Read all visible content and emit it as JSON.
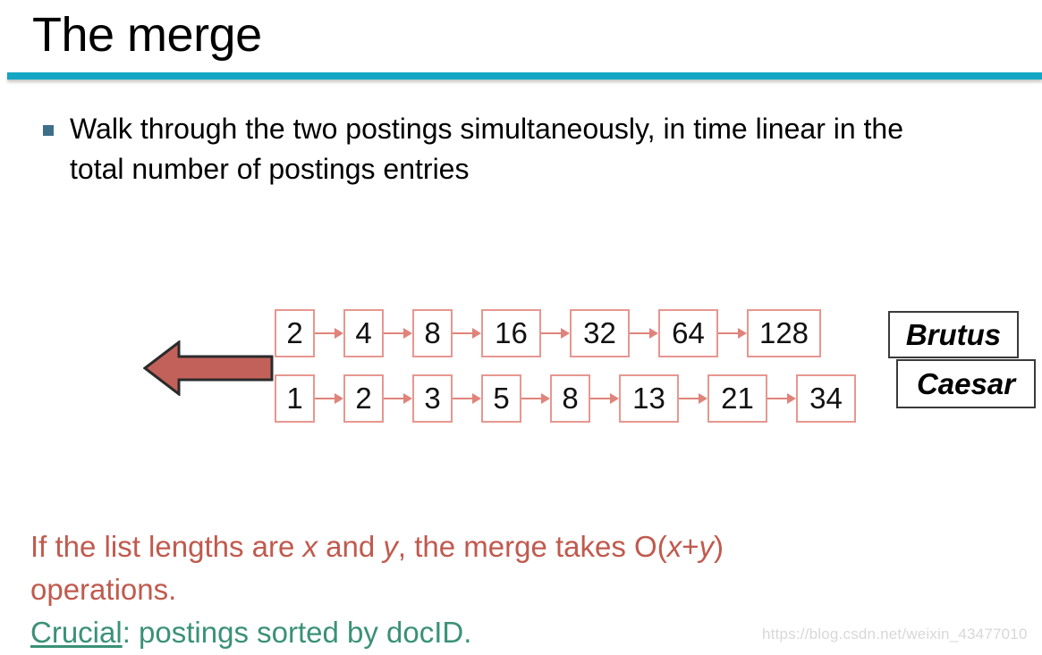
{
  "slide": {
    "title": "The merge",
    "rule_color": "#14a6c4"
  },
  "bullet": {
    "marker": "square-bullet",
    "marker_color": "#3d6e8a",
    "text": "Walk through the two postings simultaneously, in time linear in the total number of postings entries"
  },
  "diagram": {
    "arrow": {
      "name": "big-left-arrow",
      "direction": "left",
      "fill_color": "#c2615a",
      "stroke_color": "#2b2b2b"
    },
    "box_border_color": "#e79790",
    "connector_color": "#e0837a",
    "rows": [
      {
        "term": "Brutus",
        "postings": [
          "2",
          "4",
          "8",
          "16",
          "32",
          "64",
          "128"
        ]
      },
      {
        "term": "Caesar",
        "postings": [
          "1",
          "2",
          "3",
          "5",
          "8",
          "13",
          "21",
          "34"
        ]
      }
    ]
  },
  "bottom": {
    "line1_part1": "If the list lengths are ",
    "line1_x": "x",
    "line1_part2": " and ",
    "line1_y": "y",
    "line1_part3": ", the merge takes O(",
    "line1_x2": "x",
    "line1_plus": "+",
    "line1_y2": "y",
    "line1_part4": ")",
    "line2": "operations.",
    "line3_underlined": "Crucial",
    "line3_rest": ": postings sorted by docID.",
    "red_color": "#c05a4e",
    "green_color": "#3a9177"
  },
  "watermark": {
    "text": "https://blog.csdn.net/weixin_43477010"
  }
}
